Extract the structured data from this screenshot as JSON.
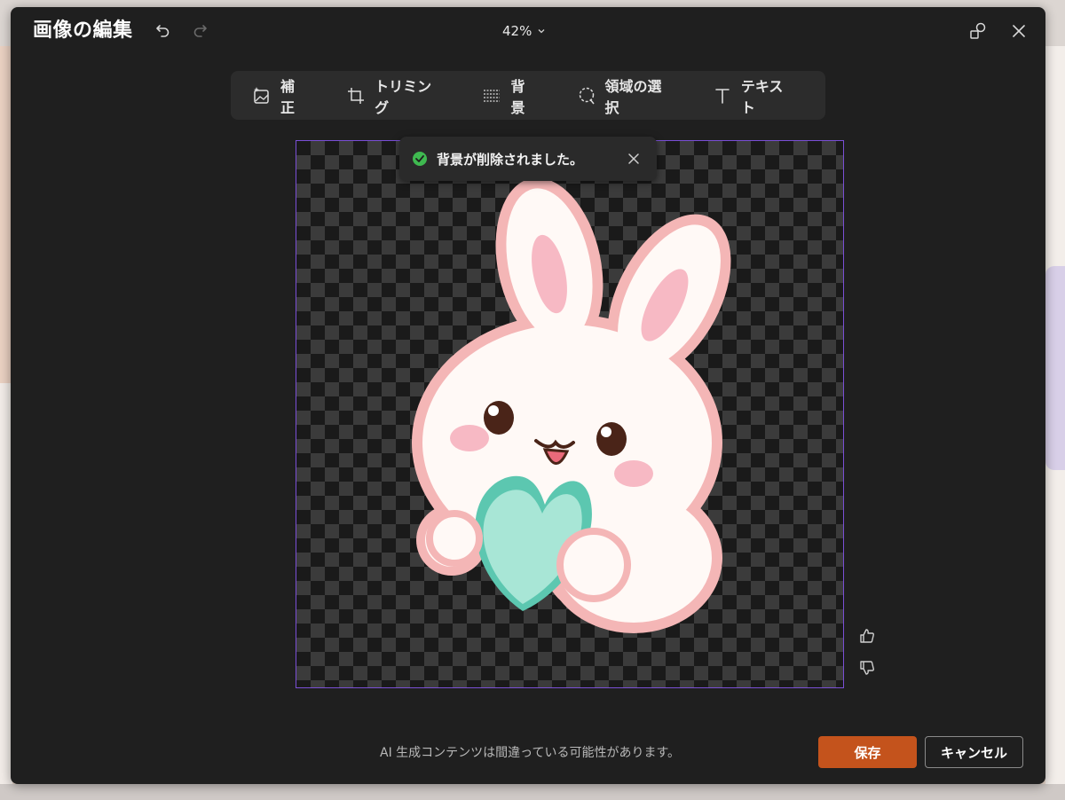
{
  "dialog": {
    "title": "画像の編集",
    "zoom": "42%"
  },
  "toolbar": {
    "items": [
      {
        "label": "補正",
        "icon": "image-sparkle-icon"
      },
      {
        "label": "トリミング",
        "icon": "crop-icon"
      },
      {
        "label": "背景",
        "icon": "background-icon"
      },
      {
        "label": "領域の選択",
        "icon": "lasso-select-icon"
      },
      {
        "label": "テキスト",
        "icon": "text-icon"
      }
    ]
  },
  "toast": {
    "message": "背景が削除されました。",
    "status": "success"
  },
  "footer": {
    "disclaimer": "AI 生成コンテンツは間違っている可能性があります。",
    "save_label": "保存",
    "cancel_label": "キャンセル"
  },
  "colors": {
    "accent": "#c4531c",
    "canvas_border": "#7a4fd6",
    "success": "#3fb950",
    "dialog_bg": "#1f1f1f"
  }
}
